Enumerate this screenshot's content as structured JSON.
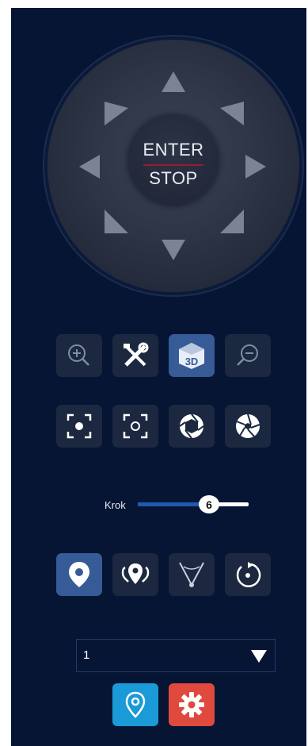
{
  "ptz": {
    "enter_label": "ENTER",
    "stop_label": "STOP",
    "icons": [
      "arrow-up-icon",
      "arrow-up-right-icon",
      "arrow-right-icon",
      "arrow-down-right-icon",
      "arrow-down-icon",
      "arrow-down-left-icon",
      "arrow-left-icon",
      "arrow-up-left-icon"
    ]
  },
  "toolbar_row1": [
    {
      "icon": "zoom-in-icon",
      "active": false
    },
    {
      "icon": "tools-icon",
      "active": false
    },
    {
      "icon": "3d-icon",
      "text": "3D",
      "active": true
    },
    {
      "icon": "zoom-out-icon",
      "active": false
    }
  ],
  "toolbar_row2": [
    {
      "icon": "focus-near-icon",
      "active": false
    },
    {
      "icon": "focus-far-icon",
      "active": false
    },
    {
      "icon": "iris-open-icon",
      "active": false
    },
    {
      "icon": "iris-close-icon",
      "active": false
    }
  ],
  "step": {
    "label": "Krok",
    "value": "6",
    "fraction": 0.64
  },
  "toolbar_row3": [
    {
      "icon": "preset-icon",
      "active": true
    },
    {
      "icon": "tour-icon",
      "active": false
    },
    {
      "icon": "pattern-icon",
      "active": false
    },
    {
      "icon": "rotate-icon",
      "active": false
    }
  ],
  "preset_select": {
    "value": "1"
  },
  "actions": {
    "goto_color": "#1a9ad6",
    "settings_color": "#e04a3e",
    "icons": [
      "location-pin-icon",
      "gear-icon"
    ]
  },
  "colors": {
    "panel": "#071535",
    "button": "#1b2840",
    "active": "#375b96",
    "accent": "#1d5ab0"
  }
}
